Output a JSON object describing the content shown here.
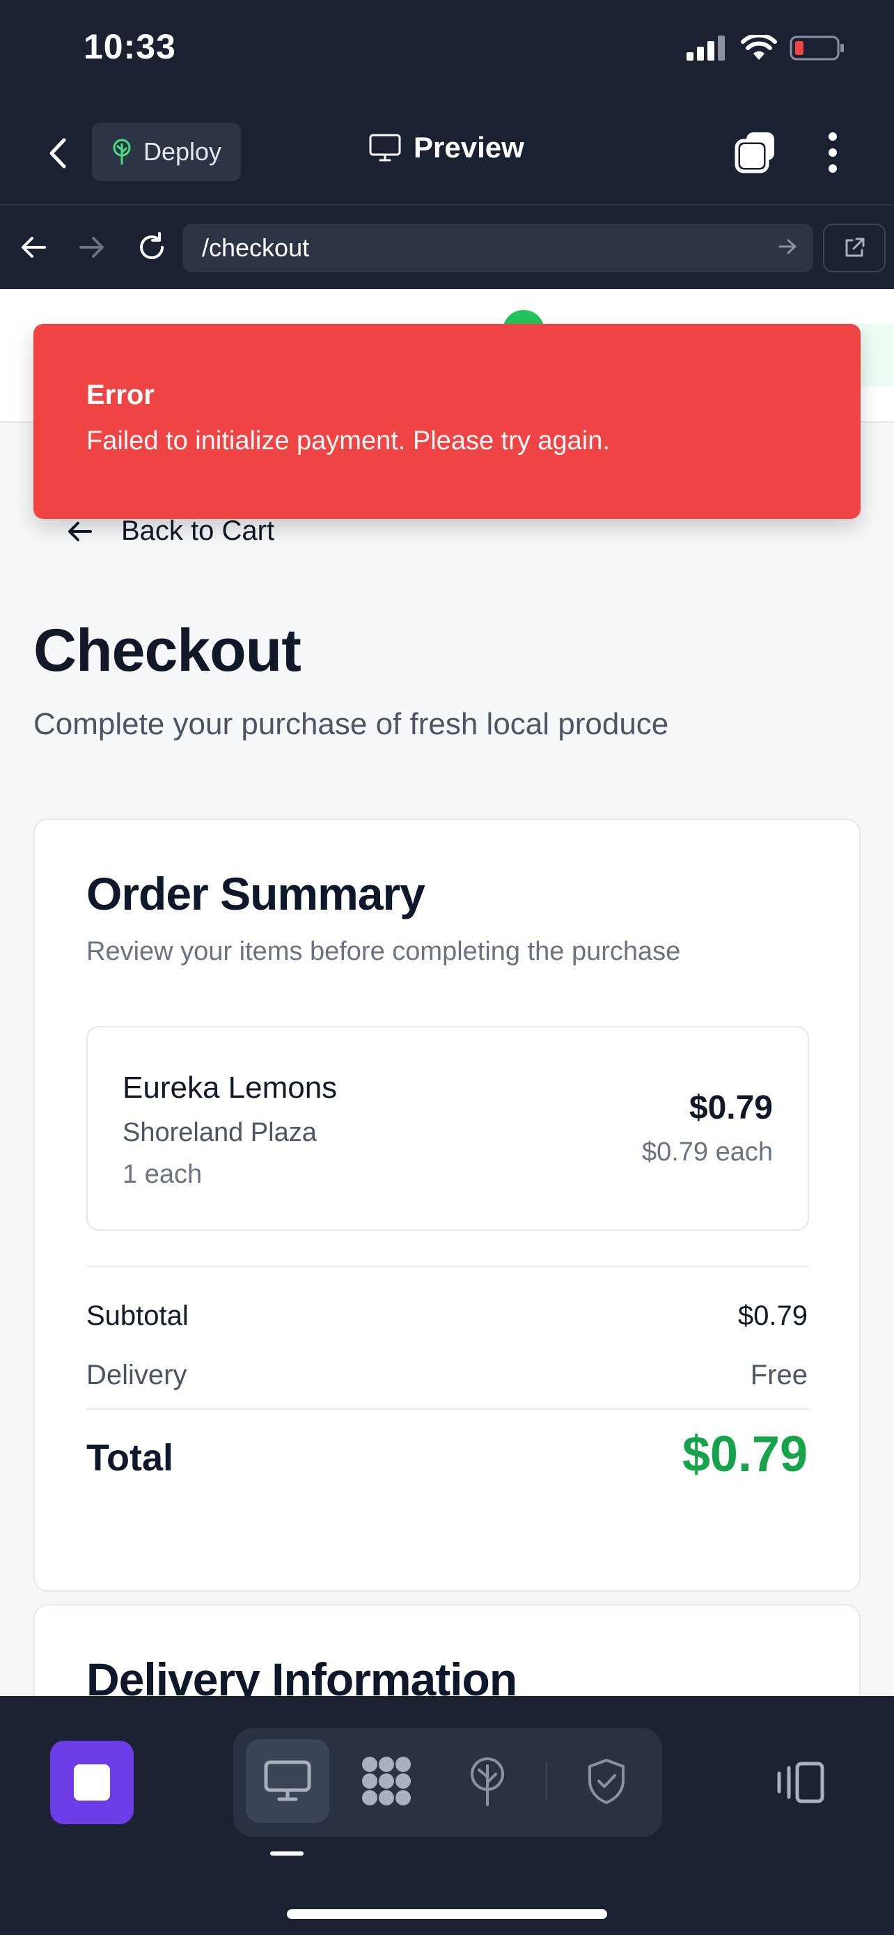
{
  "status": {
    "time": "10:33"
  },
  "header": {
    "deploy_label": "Deploy",
    "preview_label": "Preview"
  },
  "urlbar": {
    "path": "/checkout"
  },
  "toast": {
    "title": "Error",
    "message": "Failed to initialize payment. Please try again."
  },
  "page": {
    "back_label": "Back to Cart",
    "title": "Checkout",
    "subtitle": "Complete your purchase of fresh local produce"
  },
  "order_summary": {
    "title": "Order Summary",
    "description": "Review your items before completing the purchase",
    "items": [
      {
        "name": "Eureka Lemons",
        "store": "Shoreland Plaza",
        "quantity": "1 each",
        "price": "$0.79",
        "unit_price": "$0.79 each"
      }
    ],
    "subtotal_label": "Subtotal",
    "subtotal_value": "$0.79",
    "delivery_label": "Delivery",
    "delivery_value": "Free",
    "total_label": "Total",
    "total_value": "$0.79"
  },
  "delivery_info": {
    "title": "Delivery Information"
  },
  "colors": {
    "chrome_bg": "#1b2131",
    "error": "#ef4444",
    "total_green": "#16a34a",
    "stop_purple": "#6d3ee8",
    "battery_low": "#ef4444"
  },
  "icons": {
    "back": "chevron-left-icon",
    "deploy": "tree-icon",
    "preview": "monitor-icon",
    "tabs": "tabs-icon",
    "more": "more-vertical-icon",
    "nav_back": "arrow-left-icon",
    "nav_forward": "arrow-right-icon",
    "reload": "reload-icon",
    "go": "arrow-right-icon",
    "external": "external-link-icon",
    "toolbar": [
      "stop-icon",
      "monitor-icon",
      "grid-icon",
      "tree-icon",
      "shield-check-icon",
      "device-toggle-icon"
    ]
  }
}
